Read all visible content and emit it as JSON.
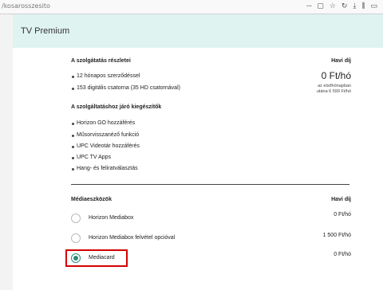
{
  "browser": {
    "url": "/kosarosszesito",
    "icons": [
      "more-icon",
      "bookmark-icon",
      "star-icon",
      "reload-icon",
      "download-icon",
      "library-icon",
      "sidebar-icon"
    ]
  },
  "card": {
    "title": "TV Premium"
  },
  "details": {
    "heading": "A szolgátatás részletei",
    "items": [
      "12 hónapos szerződéssel",
      "153 digitális csatorna (35 HD csatornával)"
    ]
  },
  "price": {
    "heading": "Havi díj",
    "value": "0 Ft/hó",
    "note_line1": "az elsőhónapban",
    "note_line2": "utána 6 599 Ft/hó"
  },
  "extras": {
    "heading": "A szolgáltatáshoz járó kiegészítők",
    "items": [
      "Horizon GO hozzáférés",
      "Műsorvisszanéző funkció",
      "UPC Videotár hozzáférés",
      "UPC TV Apps",
      "Hang- és feliratválasztás"
    ]
  },
  "devices": {
    "heading": "Médiaeszközök",
    "price_heading": "Havi díj",
    "options": [
      {
        "label": "Horizon Mediabox",
        "price": "0 Ft/hó",
        "selected": false
      },
      {
        "label": "Horizon Mediabox felvétel opcióval",
        "price": "1 500 Ft/hó",
        "selected": false
      },
      {
        "label": "Mediacard",
        "price": "0 Ft/hó",
        "selected": true
      }
    ]
  },
  "colors": {
    "accent": "#2e8b7a",
    "header_bg": "#dff3f0",
    "highlight": "#d40000"
  }
}
